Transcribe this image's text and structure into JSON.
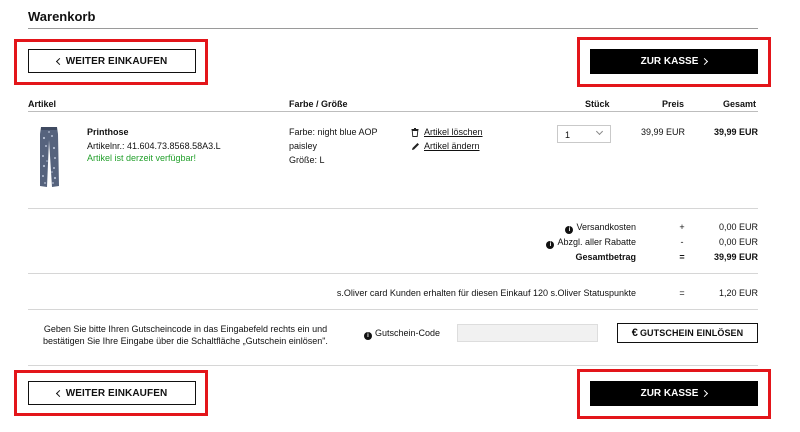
{
  "header": {
    "title": "Warenkorb"
  },
  "buttons": {
    "continue_label": "WEITER EINKAUFEN",
    "checkout_label": "ZUR KASSE",
    "coupon_label": "GUTSCHEIN EINLÖSEN"
  },
  "table": {
    "columns": {
      "article": "Artikel",
      "color_size": "Farbe / Größe",
      "qty": "Stück",
      "price": "Preis",
      "total": "Gesamt"
    }
  },
  "item": {
    "name": "Printhose",
    "article_no": "Artikelnr.: 41.604.73.8568.58A3.L",
    "availability": "Artikel ist derzeit verfügbar!",
    "color_line1": "Farbe: night blue AOP",
    "color_line2": "paisley",
    "size": "Größe: L",
    "delete_label": "Artikel löschen",
    "edit_label": "Artikel ändern",
    "quantity": "1",
    "price": "39,99 EUR",
    "total": "39,99 EUR"
  },
  "summary": {
    "shipping_label": "Versandkosten",
    "shipping_sign": "+",
    "shipping_value": "0,00 EUR",
    "discount_label": "Abzgl. aller Rabatte",
    "discount_sign": "-",
    "discount_value": "0,00 EUR",
    "total_label": "Gesamtbetrag",
    "total_sign": "=",
    "total_value": "39,99 EUR"
  },
  "loyalty": {
    "text": "s.Oliver card Kunden erhalten für diesen Einkauf 120 s.Oliver Statuspunkte",
    "sign": "=",
    "value": "1,20 EUR"
  },
  "coupon": {
    "instructions_line1": "Geben Sie bitte Ihren Gutscheincode in das Eingabefeld rechts ein und",
    "instructions_line2": "bestätigen Sie Ihre Eingabe über die Schaltfläche „Gutschein einlösen\".",
    "code_label": "Gutschein-Code",
    "code_value": ""
  },
  "colors": {
    "highlight": "#e3151a",
    "available": "#23a02c",
    "button_dark": "#000000"
  },
  "icons": [
    "chevron-left-icon",
    "chevron-right-icon",
    "trash-icon",
    "pencil-icon",
    "info-icon",
    "euro-icon",
    "chevron-down-icon"
  ]
}
